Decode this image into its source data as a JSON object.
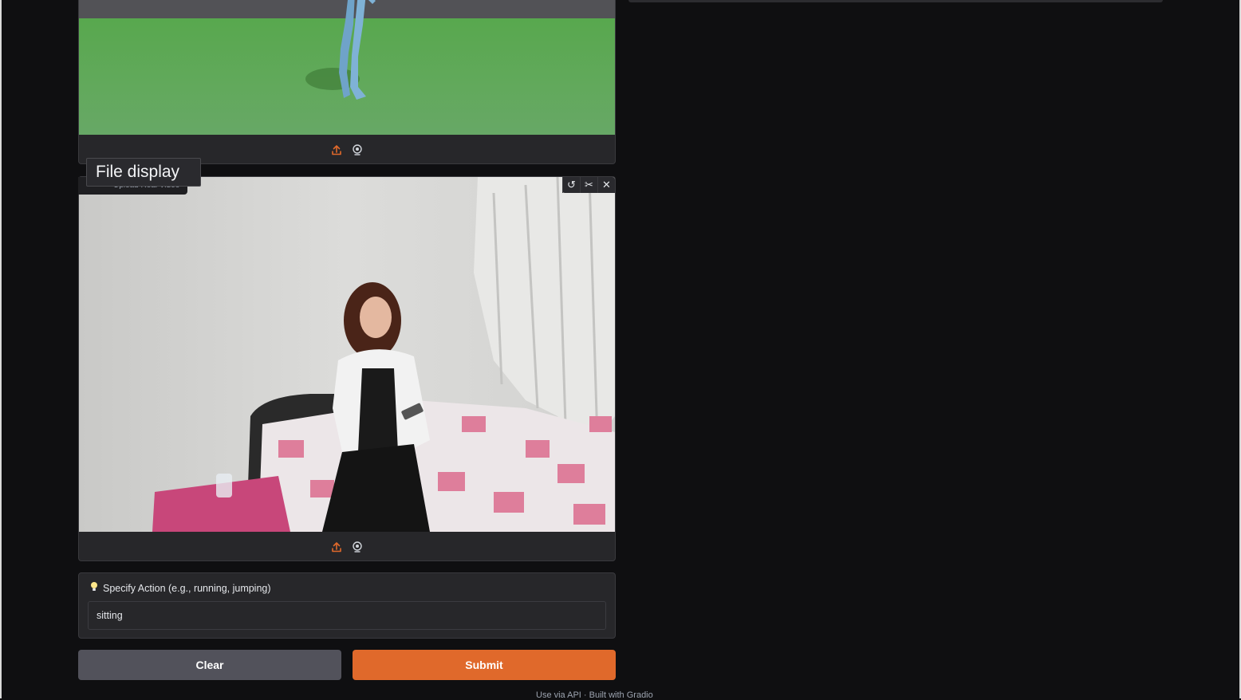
{
  "tooltip": {
    "text": "File display"
  },
  "video_bottom": {
    "label": "Upload Real Video"
  },
  "action": {
    "label": "Specify Action (e.g., running, jumping)",
    "value": "sitting",
    "icon": "lightbulb-icon"
  },
  "buttons": {
    "clear": "Clear",
    "submit": "Submit"
  },
  "footer": {
    "api_text": "Use via API",
    "built_text": "Built with Gradio"
  },
  "colors": {
    "accent": "#e0692b",
    "background": "#0f0f11",
    "panel": "#27272a",
    "secondary_button": "#52525b"
  }
}
